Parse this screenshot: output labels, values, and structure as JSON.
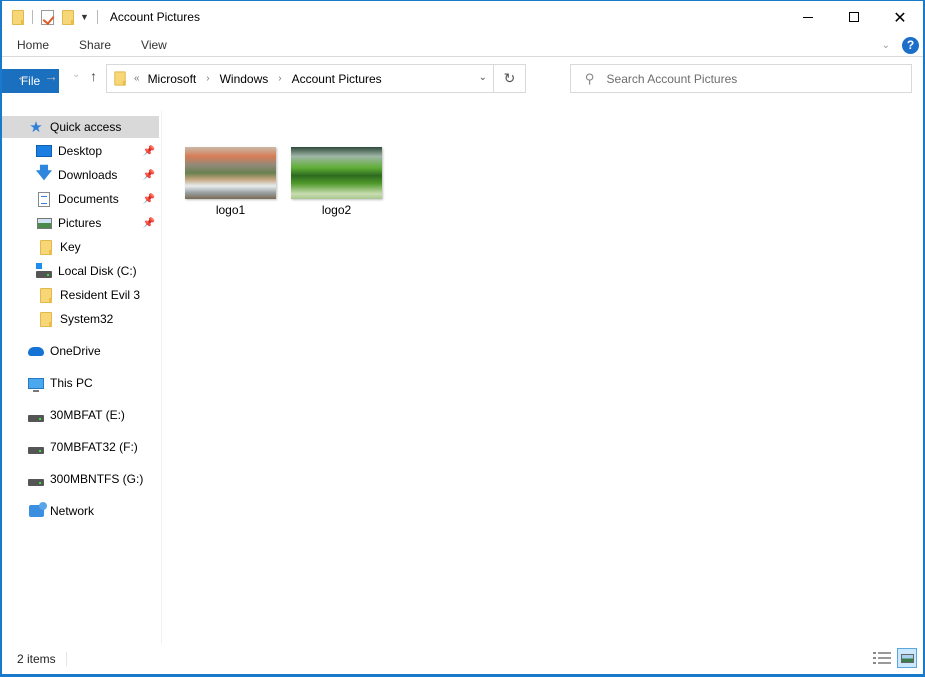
{
  "window": {
    "title": "Account Pictures",
    "controls": {
      "minimize": "minimize",
      "maximize": "maximize",
      "close": "close"
    }
  },
  "ribbon": {
    "tabs": [
      {
        "label": "File",
        "active": true
      },
      {
        "label": "Home"
      },
      {
        "label": "Share"
      },
      {
        "label": "View"
      }
    ],
    "help_label": "?"
  },
  "navigation": {
    "back": "←",
    "forward": "→",
    "recent": "⌄",
    "up": "↑",
    "breadcrumb_overflow": "«",
    "breadcrumb": [
      "Microsoft",
      "Windows",
      "Account Pictures"
    ],
    "refresh": "↻",
    "search_placeholder": "Search Account Pictures"
  },
  "sidebar": {
    "quick_access": {
      "label": "Quick access",
      "selected": true
    },
    "pinned": [
      {
        "label": "Desktop",
        "icon": "desktop-icon",
        "pinned": true
      },
      {
        "label": "Downloads",
        "icon": "downloads-icon",
        "pinned": true
      },
      {
        "label": "Documents",
        "icon": "documents-icon",
        "pinned": true
      },
      {
        "label": "Pictures",
        "icon": "pictures-icon",
        "pinned": true
      },
      {
        "label": "Key",
        "icon": "folder-icon"
      },
      {
        "label": "Local Disk (C:)",
        "icon": "local-disk-icon"
      },
      {
        "label": "Resident Evil 3",
        "icon": "folder-icon"
      },
      {
        "label": "System32",
        "icon": "folder-icon"
      }
    ],
    "roots": [
      {
        "label": "OneDrive",
        "icon": "onedrive-icon"
      },
      {
        "label": "This PC",
        "icon": "this-pc-icon"
      },
      {
        "label": "30MBFAT (E:)",
        "icon": "drive-icon"
      },
      {
        "label": "70MBFAT32 (F:)",
        "icon": "drive-icon"
      },
      {
        "label": "300MBNTFS (G:)",
        "icon": "drive-icon"
      },
      {
        "label": "Network",
        "icon": "network-icon"
      }
    ]
  },
  "files": [
    {
      "name": "logo1",
      "thumbnail": "mountain-lake-waterfall"
    },
    {
      "name": "logo2",
      "thumbnail": "green-trees-lake"
    }
  ],
  "status": {
    "item_count": "2 items",
    "view_mode": "large-icons"
  }
}
